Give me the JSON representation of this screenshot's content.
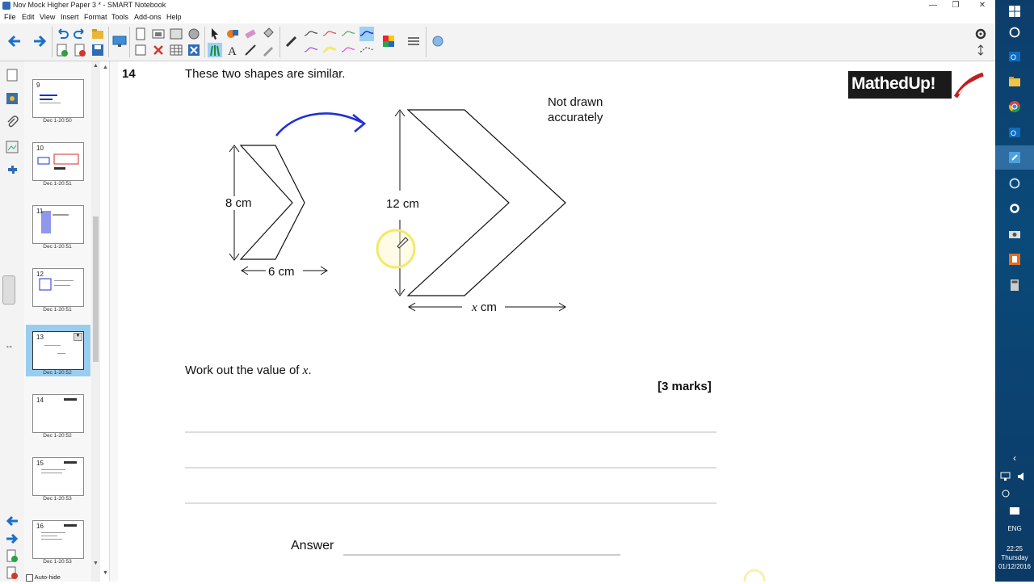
{
  "window": {
    "title": "Nov Mock Higher Paper 3 * - SMART Notebook"
  },
  "menu": [
    "File",
    "Edit",
    "View",
    "Insert",
    "Format",
    "Tools",
    "Add-ons",
    "Help"
  ],
  "sorter": {
    "pages": [
      {
        "num": "9",
        "date": "Dec 1-20:50"
      },
      {
        "num": "10",
        "date": "Dec 1-20:51"
      },
      {
        "num": "11",
        "date": "Dec 1-20:51"
      },
      {
        "num": "12",
        "date": "Dec 1-20:51"
      },
      {
        "num": "13",
        "date": "Dec 1-20:52"
      },
      {
        "num": "14",
        "date": "Dec 1-20:52"
      },
      {
        "num": "15",
        "date": "Dec 1-20:53"
      },
      {
        "num": "16",
        "date": "Dec 1-20:53"
      }
    ],
    "selected_index": 4,
    "autohide_label": "Auto-hide"
  },
  "question": {
    "number": "14",
    "prompt": "These two shapes are similar.",
    "note_line1": "Not drawn",
    "note_line2": "accurately",
    "small_height": "8 cm",
    "small_width": "6 cm",
    "large_height": "12 cm",
    "large_width_var": "x",
    "large_width_unit": " cm",
    "work_prefix": "Work out the value of ",
    "work_var": "x",
    "work_suffix": ".",
    "marks": "[3 marks]",
    "answer_label": "Answer"
  },
  "logo": {
    "text": "MathedUp!"
  },
  "colors": {
    "ink_blue": "#1f2fd6",
    "highlight_yellow": "#f2e96a",
    "selected_thumb": "#99cdf0"
  },
  "taskbar": {
    "language": "ENG",
    "time": "22:25",
    "day": "Thursday",
    "date": "01/12/2016"
  }
}
